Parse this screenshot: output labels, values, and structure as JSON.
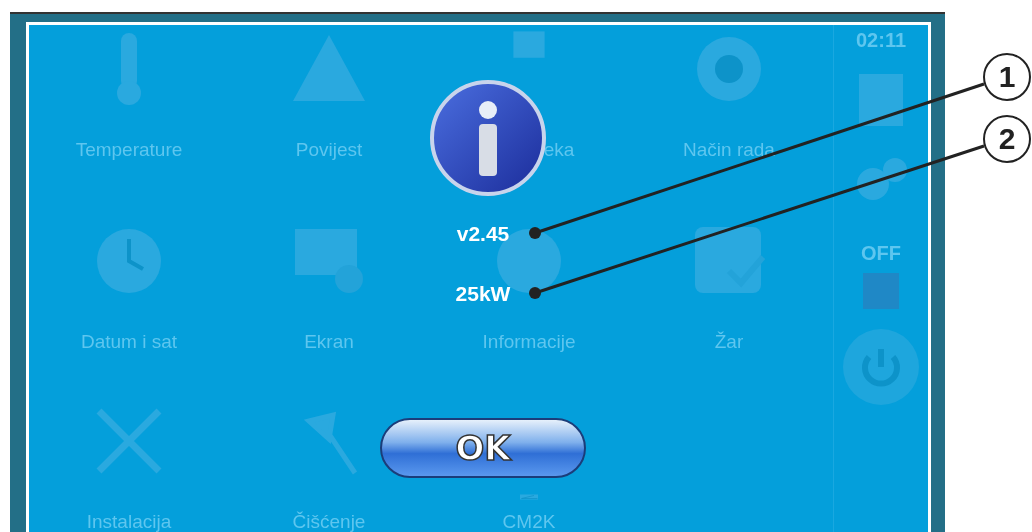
{
  "tiles": [
    {
      "label": "Temperature"
    },
    {
      "label": "Povijest"
    },
    {
      "label": "eka"
    },
    {
      "label": "Način rada"
    },
    {
      "label": "Datum i sat"
    },
    {
      "label": "Ekran"
    },
    {
      "label": "Informacije"
    },
    {
      "label": "Žar"
    },
    {
      "label": "Instalacija"
    },
    {
      "label": "Čišćenje"
    },
    {
      "label": "CM2K"
    }
  ],
  "sidebar": {
    "time": "02:11",
    "status": "OFF"
  },
  "dialog": {
    "version": "v2.45",
    "power": "25kW",
    "ok_button": "OK"
  },
  "callouts": [
    {
      "number": "1"
    },
    {
      "number": "2"
    }
  ]
}
